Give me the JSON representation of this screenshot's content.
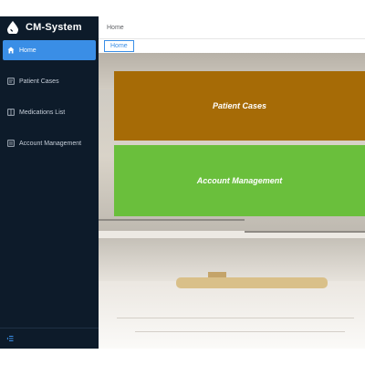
{
  "app": {
    "name": "CM-System",
    "logo_icon": "drop-icon"
  },
  "sidebar": {
    "items": [
      {
        "label": "Home",
        "icon": "home-icon",
        "active": true
      },
      {
        "label": "Patient Cases",
        "icon": "document-icon",
        "active": false
      },
      {
        "label": "Medications List",
        "icon": "list-icon",
        "active": false
      },
      {
        "label": "Account Management",
        "icon": "account-icon",
        "active": false
      }
    ],
    "collapse_icon": "collapse-icon"
  },
  "header": {
    "breadcrumb": "Home"
  },
  "tabs": [
    {
      "label": "Home",
      "active": true
    }
  ],
  "cards": [
    {
      "label": "Patient Cases",
      "color": "#a66b06"
    },
    {
      "label": "Account Management",
      "color": "#6abf3c"
    }
  ],
  "colors": {
    "sidebar_bg": "#0d1b2a",
    "accent": "#3a8ee6"
  }
}
